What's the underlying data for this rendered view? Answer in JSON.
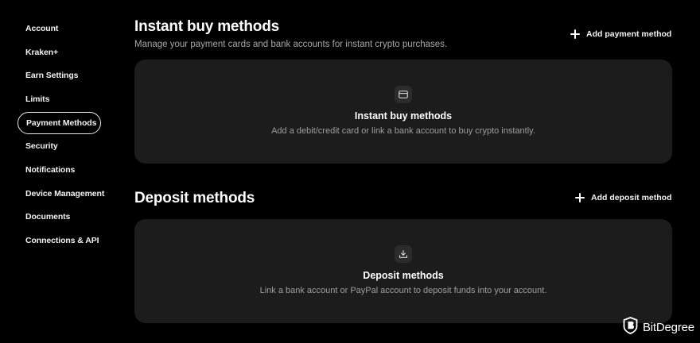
{
  "sidebar": {
    "items": [
      {
        "label": "Account"
      },
      {
        "label": "Kraken+"
      },
      {
        "label": "Earn Settings"
      },
      {
        "label": "Limits"
      },
      {
        "label": "Payment Methods",
        "active": true
      },
      {
        "label": "Security"
      },
      {
        "label": "Notifications"
      },
      {
        "label": "Device Management"
      },
      {
        "label": "Documents"
      },
      {
        "label": "Connections & API"
      }
    ]
  },
  "instant": {
    "title": "Instant buy methods",
    "subtitle": "Manage your payment cards and bank accounts for instant crypto purchases.",
    "add_label": "Add payment method",
    "card": {
      "icon": "credit-card-icon",
      "title": "Instant buy methods",
      "text": "Add a debit/credit card or link a bank account to buy crypto instantly."
    }
  },
  "deposit": {
    "title": "Deposit methods",
    "add_label": "Add deposit method",
    "card": {
      "icon": "download-icon",
      "title": "Deposit methods",
      "text": "Link a bank account or PayPal account to deposit funds into your account."
    }
  },
  "watermark": {
    "text": "BitDegree",
    "icon": "bitdegree-logo-icon"
  },
  "colors": {
    "background": "#000000",
    "card": "#1c1c1c",
    "muted_text": "#9e9e9e"
  }
}
